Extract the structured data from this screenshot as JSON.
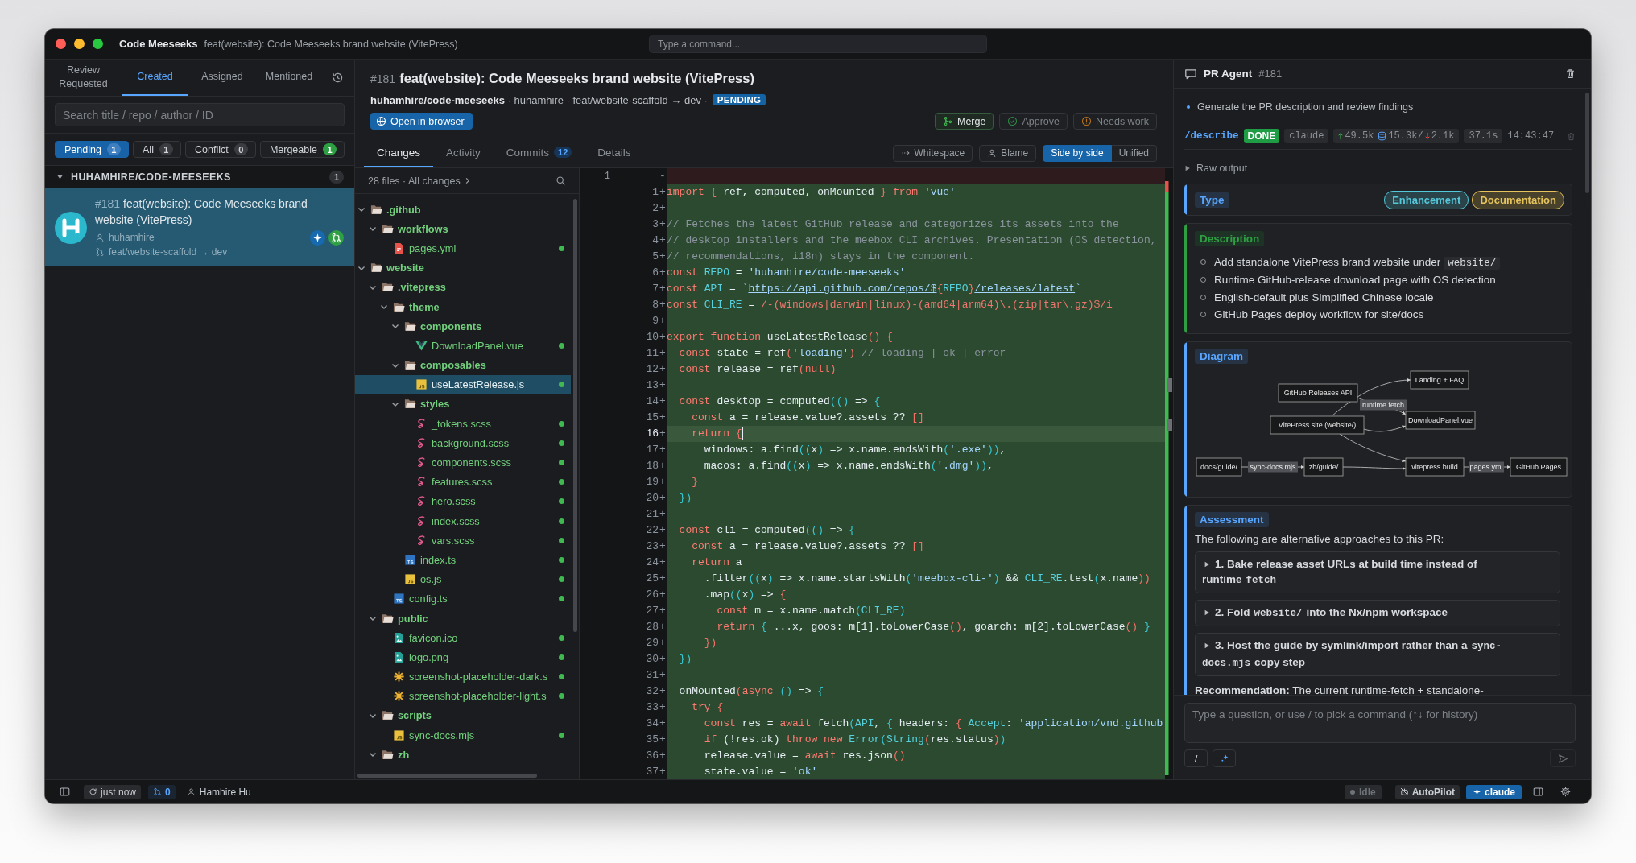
{
  "window": {
    "app_name": "Code Meeseeks",
    "title": "feat(website): Code Meeseeks brand website (VitePress)",
    "command_placeholder": "Type a command..."
  },
  "sidebar": {
    "tabs": [
      {
        "label": "Review Requested",
        "selected": false
      },
      {
        "label": "Created",
        "selected": true
      },
      {
        "label": "Assigned",
        "selected": false
      },
      {
        "label": "Mentioned",
        "selected": false
      }
    ],
    "search_placeholder": "Search title / repo / author / ID",
    "filters": [
      {
        "label": "Pending",
        "count": "1",
        "kind": "default",
        "selected": true
      },
      {
        "label": "All",
        "count": "1",
        "kind": "default",
        "selected": false
      },
      {
        "label": "Conflict",
        "count": "0",
        "kind": "default",
        "selected": false
      },
      {
        "label": "Mergeable",
        "count": "1",
        "kind": "success",
        "selected": false
      }
    ],
    "groups": [
      {
        "name": "HUHAMHIRE/CODE-MEESEEKS",
        "count": "1",
        "expanded": true,
        "items": [
          {
            "number": "#181",
            "title": "feat(website): Code Meeseeks brand website (VitePress)",
            "author": "huhamhire",
            "branch": "feat/website-scaffold → dev",
            "selected": true
          }
        ]
      }
    ]
  },
  "pull_request": {
    "number": "#181",
    "title": "feat(website): Code Meeseeks brand website (VitePress)",
    "meta": "**huhamhire/code-meeseeks** · huhamhire · feat/website-scaffold → dev ·",
    "status": "PENDING",
    "open_button": "Open in browser",
    "actions": [
      {
        "label": "Merge",
        "kind": "merge",
        "disabled": false
      },
      {
        "label": "Approve",
        "kind": "approve",
        "disabled": true
      },
      {
        "label": "Needs work",
        "kind": "needs_work",
        "disabled": true
      }
    ],
    "tabs": [
      {
        "label": "Changes",
        "selected": true
      },
      {
        "label": "Activity",
        "selected": false
      },
      {
        "label": "Commits",
        "count": "12",
        "selected": false
      },
      {
        "label": "Details",
        "selected": false
      }
    ],
    "view_options": [
      {
        "label": "Whitespace",
        "kind": "whitespace"
      },
      {
        "label": "Blame",
        "kind": "blame"
      }
    ],
    "layouts": [
      {
        "label": "Side by side",
        "selected": true
      },
      {
        "label": "Unified",
        "selected": false
      }
    ]
  },
  "file_tree": {
    "summary": "28 files · All changes",
    "items": [
      {
        "kind": "folder",
        "name": ".github",
        "expanded": true,
        "added": false,
        "selected": false,
        "children": [
          {
            "kind": "folder",
            "name": "workflows",
            "expanded": true,
            "added": false,
            "selected": false,
            "children": [
              {
                "kind": "yml",
                "name": "pages.yml",
                "added": true,
                "selected": false
              }
            ]
          }
        ]
      },
      {
        "kind": "folder",
        "name": "website",
        "expanded": true,
        "added": false,
        "selected": false,
        "children": [
          {
            "kind": "folder",
            "name": ".vitepress",
            "expanded": true,
            "added": false,
            "selected": false,
            "children": [
              {
                "kind": "folder",
                "name": "theme",
                "expanded": true,
                "added": false,
                "selected": false,
                "children": [
                  {
                    "kind": "folder",
                    "name": "components",
                    "expanded": true,
                    "added": false,
                    "selected": false,
                    "children": [
                      {
                        "kind": "vue",
                        "name": "DownloadPanel.vue",
                        "added": true,
                        "selected": false
                      }
                    ]
                  },
                  {
                    "kind": "folder",
                    "name": "composables",
                    "expanded": true,
                    "added": false,
                    "selected": false,
                    "children": [
                      {
                        "kind": "js",
                        "name": "useLatestRelease.js",
                        "added": true,
                        "selected": true
                      }
                    ]
                  },
                  {
                    "kind": "folder",
                    "name": "styles",
                    "expanded": true,
                    "added": false,
                    "selected": false,
                    "children": [
                      {
                        "kind": "scss",
                        "name": "_tokens.scss",
                        "added": true,
                        "selected": false
                      },
                      {
                        "kind": "scss",
                        "name": "background.scss",
                        "added": true,
                        "selected": false
                      },
                      {
                        "kind": "scss",
                        "name": "components.scss",
                        "added": true,
                        "selected": false
                      },
                      {
                        "kind": "scss",
                        "name": "features.scss",
                        "added": true,
                        "selected": false
                      },
                      {
                        "kind": "scss",
                        "name": "hero.scss",
                        "added": true,
                        "selected": false
                      },
                      {
                        "kind": "scss",
                        "name": "index.scss",
                        "added": true,
                        "selected": false
                      },
                      {
                        "kind": "scss",
                        "name": "vars.scss",
                        "added": true,
                        "selected": false
                      }
                    ]
                  },
                  {
                    "kind": "ts",
                    "name": "index.ts",
                    "added": true,
                    "selected": false
                  },
                  {
                    "kind": "js",
                    "name": "os.js",
                    "added": true,
                    "selected": false
                  }
                ]
              },
              {
                "kind": "ts",
                "name": "config.ts",
                "added": true,
                "selected": false
              }
            ]
          },
          {
            "kind": "folder",
            "name": "public",
            "expanded": true,
            "added": false,
            "selected": false,
            "children": [
              {
                "kind": "image",
                "name": "favicon.ico",
                "added": true,
                "selected": false
              },
              {
                "kind": "image",
                "name": "logo.png",
                "added": true,
                "selected": false
              },
              {
                "kind": "svg",
                "name": "screenshot-placeholder-dark.s",
                "added": true,
                "selected": false
              },
              {
                "kind": "svg",
                "name": "screenshot-placeholder-light.s",
                "added": true,
                "selected": false
              }
            ]
          },
          {
            "kind": "folder",
            "name": "scripts",
            "expanded": true,
            "added": false,
            "selected": false,
            "children": [
              {
                "kind": "js",
                "name": "sync-docs.mjs",
                "added": true,
                "selected": false
              }
            ]
          },
          {
            "kind": "folder",
            "name": "zh",
            "expanded": true,
            "added": false,
            "selected": false
          }
        ]
      }
    ]
  },
  "diff": {
    "rows": [
      {
        "kind": "removed",
        "number": "1",
        "marker": "-",
        "active": false
      },
      {
        "kind": "added",
        "number": "1",
        "marker": "+",
        "active": false,
        "tokens": [
          {
            "kind": "kw",
            "text": "import "
          },
          {
            "kind": "b1",
            "text": "{"
          },
          {
            "kind": "p",
            "text": " ref, computed, onMounted "
          },
          {
            "kind": "b1",
            "text": "}"
          },
          {
            "kind": "kw",
            "text": " from "
          },
          {
            "kind": "str",
            "text": "'vue'"
          }
        ]
      },
      {
        "kind": "added",
        "number": "2",
        "marker": "+",
        "active": false
      },
      {
        "kind": "added",
        "number": "3",
        "marker": "+",
        "active": false,
        "tokens": [
          {
            "kind": "cm",
            "text": "// Fetches the latest GitHub release and categorizes its assets into the"
          }
        ]
      },
      {
        "kind": "added",
        "number": "4",
        "marker": "+",
        "active": false,
        "tokens": [
          {
            "kind": "cm",
            "text": "// desktop installers and the meebox CLI archives. Presentation (OS detection,"
          }
        ]
      },
      {
        "kind": "added",
        "number": "5",
        "marker": "+",
        "active": false,
        "tokens": [
          {
            "kind": "cm",
            "text": "// recommendations, i18n) stays in the component."
          }
        ]
      },
      {
        "kind": "added",
        "number": "6",
        "marker": "+",
        "active": false,
        "tokens": [
          {
            "kind": "kw",
            "text": "const "
          },
          {
            "kind": "cn",
            "text": "REPO"
          },
          {
            "kind": "p",
            "text": " = "
          },
          {
            "kind": "str",
            "text": "'huhamhire/code-meeseeks'"
          }
        ]
      },
      {
        "kind": "added",
        "number": "7",
        "marker": "+",
        "active": false,
        "tokens": [
          {
            "kind": "kw",
            "text": "const "
          },
          {
            "kind": "cn",
            "text": "API"
          },
          {
            "kind": "p",
            "text": " = "
          },
          {
            "kind": "str",
            "text": "`"
          },
          {
            "kind": "url",
            "text": "https://api.github.com/repos/$"
          },
          {
            "kind": "b1",
            "text": "{"
          },
          {
            "kind": "cn",
            "text": "REPO"
          },
          {
            "kind": "b1",
            "text": "}"
          },
          {
            "kind": "url",
            "text": "/releases/latest"
          },
          {
            "kind": "str",
            "text": "`"
          }
        ]
      },
      {
        "kind": "added",
        "number": "8",
        "marker": "+",
        "active": false,
        "tokens": [
          {
            "kind": "kw",
            "text": "const "
          },
          {
            "kind": "cn",
            "text": "CLI_RE"
          },
          {
            "kind": "p",
            "text": " = "
          },
          {
            "kind": "re",
            "text": "/-(windows|darwin|linux)-(amd64|arm64)\\.(zip|tar\\.gz)$/i"
          }
        ]
      },
      {
        "kind": "added",
        "number": "9",
        "marker": "+",
        "active": false
      },
      {
        "kind": "added",
        "number": "10",
        "marker": "+",
        "active": false,
        "tokens": [
          {
            "kind": "kw",
            "text": "export function "
          },
          {
            "kind": "p",
            "text": "useLatestRelease"
          },
          {
            "kind": "b1",
            "text": "() {"
          }
        ]
      },
      {
        "kind": "added",
        "number": "11",
        "marker": "+",
        "active": false,
        "tokens": [
          {
            "kind": "kw",
            "text": "  const "
          },
          {
            "kind": "p",
            "text": "state = ref"
          },
          {
            "kind": "b1",
            "text": "("
          },
          {
            "kind": "str",
            "text": "'loading'"
          },
          {
            "kind": "b1",
            "text": ")"
          },
          {
            "kind": "cm",
            "text": " // loading | ok | error"
          }
        ]
      },
      {
        "kind": "added",
        "number": "12",
        "marker": "+",
        "active": false,
        "tokens": [
          {
            "kind": "kw",
            "text": "  const "
          },
          {
            "kind": "p",
            "text": "release = ref"
          },
          {
            "kind": "b1",
            "text": "(null)"
          }
        ]
      },
      {
        "kind": "added",
        "number": "13",
        "marker": "+",
        "active": false
      },
      {
        "kind": "added",
        "number": "14",
        "marker": "+",
        "active": false,
        "tokens": [
          {
            "kind": "kw",
            "text": "  const "
          },
          {
            "kind": "p",
            "text": "desktop = computed"
          },
          {
            "kind": "b2",
            "text": "(()"
          },
          {
            "kind": "p",
            "text": " => "
          },
          {
            "kind": "b2",
            "text": "{"
          }
        ]
      },
      {
        "kind": "added",
        "number": "15",
        "marker": "+",
        "active": false,
        "tokens": [
          {
            "kind": "kw",
            "text": "    const "
          },
          {
            "kind": "p",
            "text": "a = release.value?.assets ?? "
          },
          {
            "kind": "b1",
            "text": "[]"
          }
        ]
      },
      {
        "kind": "added",
        "number": "16",
        "marker": "+",
        "active": true,
        "tokens": [
          {
            "kind": "kw",
            "text": "    return "
          },
          {
            "kind": "b1",
            "text": "{"
          }
        ]
      },
      {
        "kind": "added",
        "number": "17",
        "marker": "+",
        "active": false,
        "tokens": [
          {
            "kind": "p",
            "text": "      windows: a.find"
          },
          {
            "kind": "b2",
            "text": "(("
          },
          {
            "kind": "p",
            "text": "x"
          },
          {
            "kind": "b2",
            "text": ")"
          },
          {
            "kind": "p",
            "text": " => x.name.endsWith"
          },
          {
            "kind": "b2",
            "text": "("
          },
          {
            "kind": "str",
            "text": "'.exe'"
          },
          {
            "kind": "b2",
            "text": "))"
          },
          {
            "kind": "p",
            "text": ","
          }
        ]
      },
      {
        "kind": "added",
        "number": "18",
        "marker": "+",
        "active": false,
        "tokens": [
          {
            "kind": "p",
            "text": "      macos: a.find"
          },
          {
            "kind": "b2",
            "text": "(("
          },
          {
            "kind": "p",
            "text": "x"
          },
          {
            "kind": "b2",
            "text": ")"
          },
          {
            "kind": "p",
            "text": " => x.name.endsWith"
          },
          {
            "kind": "b2",
            "text": "("
          },
          {
            "kind": "str",
            "text": "'.dmg'"
          },
          {
            "kind": "b2",
            "text": "))"
          },
          {
            "kind": "p",
            "text": ","
          }
        ]
      },
      {
        "kind": "added",
        "number": "19",
        "marker": "+",
        "active": false,
        "tokens": [
          {
            "kind": "b1",
            "text": "    }"
          }
        ]
      },
      {
        "kind": "added",
        "number": "20",
        "marker": "+",
        "active": false,
        "tokens": [
          {
            "kind": "b2",
            "text": "  })"
          }
        ]
      },
      {
        "kind": "added",
        "number": "21",
        "marker": "+",
        "active": false
      },
      {
        "kind": "added",
        "number": "22",
        "marker": "+",
        "active": false,
        "tokens": [
          {
            "kind": "kw",
            "text": "  const "
          },
          {
            "kind": "p",
            "text": "cli = computed"
          },
          {
            "kind": "b2",
            "text": "(()"
          },
          {
            "kind": "p",
            "text": " => "
          },
          {
            "kind": "b2",
            "text": "{"
          }
        ]
      },
      {
        "kind": "added",
        "number": "23",
        "marker": "+",
        "active": false,
        "tokens": [
          {
            "kind": "kw",
            "text": "    const "
          },
          {
            "kind": "p",
            "text": "a = release.value?.assets ?? "
          },
          {
            "kind": "b1",
            "text": "[]"
          }
        ]
      },
      {
        "kind": "added",
        "number": "24",
        "marker": "+",
        "active": false,
        "tokens": [
          {
            "kind": "kw",
            "text": "    return "
          },
          {
            "kind": "p",
            "text": "a"
          }
        ]
      },
      {
        "kind": "added",
        "number": "25",
        "marker": "+",
        "active": false,
        "tokens": [
          {
            "kind": "p",
            "text": "      .filter"
          },
          {
            "kind": "b2",
            "text": "(("
          },
          {
            "kind": "p",
            "text": "x"
          },
          {
            "kind": "b2",
            "text": ")"
          },
          {
            "kind": "p",
            "text": " => x.name.startsWith"
          },
          {
            "kind": "b2",
            "text": "("
          },
          {
            "kind": "str",
            "text": "'meebox-cli-'"
          },
          {
            "kind": "b2",
            "text": ")"
          },
          {
            "kind": "p",
            "text": " && "
          },
          {
            "kind": "cn",
            "text": "CLI_RE"
          },
          {
            "kind": "p",
            "text": ".test"
          },
          {
            "kind": "b2",
            "text": "("
          },
          {
            "kind": "p",
            "text": "x.name"
          },
          {
            "kind": "b1",
            "text": "))"
          }
        ]
      },
      {
        "kind": "added",
        "number": "26",
        "marker": "+",
        "active": false,
        "tokens": [
          {
            "kind": "p",
            "text": "      .map"
          },
          {
            "kind": "b2",
            "text": "(("
          },
          {
            "kind": "p",
            "text": "x"
          },
          {
            "kind": "b2",
            "text": ")"
          },
          {
            "kind": "p",
            "text": " => "
          },
          {
            "kind": "b1",
            "text": "{"
          }
        ]
      },
      {
        "kind": "added",
        "number": "27",
        "marker": "+",
        "active": false,
        "tokens": [
          {
            "kind": "kw",
            "text": "        const "
          },
          {
            "kind": "p",
            "text": "m = x.name.match"
          },
          {
            "kind": "b2",
            "text": "("
          },
          {
            "kind": "cn",
            "text": "CLI_RE"
          },
          {
            "kind": "b2",
            "text": ")"
          }
        ]
      },
      {
        "kind": "added",
        "number": "28",
        "marker": "+",
        "active": false,
        "tokens": [
          {
            "kind": "kw",
            "text": "        return "
          },
          {
            "kind": "b2",
            "text": "{"
          },
          {
            "kind": "p",
            "text": " ...x, goos: m[1].toLowerCase"
          },
          {
            "kind": "b1",
            "text": "()"
          },
          {
            "kind": "p",
            "text": ", goarch: m[2].toLowerCase"
          },
          {
            "kind": "b1",
            "text": "() "
          },
          {
            "kind": "b2",
            "text": "}"
          }
        ]
      },
      {
        "kind": "added",
        "number": "29",
        "marker": "+",
        "active": false,
        "tokens": [
          {
            "kind": "b1",
            "text": "      })"
          }
        ]
      },
      {
        "kind": "added",
        "number": "30",
        "marker": "+",
        "active": false,
        "tokens": [
          {
            "kind": "b2",
            "text": "  })"
          }
        ]
      },
      {
        "kind": "added",
        "number": "31",
        "marker": "+",
        "active": false
      },
      {
        "kind": "added",
        "number": "32",
        "marker": "+",
        "active": false,
        "tokens": [
          {
            "kind": "p",
            "text": "  onMounted"
          },
          {
            "kind": "b1",
            "text": "("
          },
          {
            "kind": "kw",
            "text": "async "
          },
          {
            "kind": "b2",
            "text": "()"
          },
          {
            "kind": "p",
            "text": " => "
          },
          {
            "kind": "b2",
            "text": "{"
          }
        ]
      },
      {
        "kind": "added",
        "number": "33",
        "marker": "+",
        "active": false,
        "tokens": [
          {
            "kind": "kw",
            "text": "    try "
          },
          {
            "kind": "b1",
            "text": "{"
          }
        ]
      },
      {
        "kind": "added",
        "number": "34",
        "marker": "+",
        "active": false,
        "tokens": [
          {
            "kind": "kw",
            "text": "      const "
          },
          {
            "kind": "p",
            "text": "res = "
          },
          {
            "kind": "kw",
            "text": "await "
          },
          {
            "kind": "p",
            "text": "fetch"
          },
          {
            "kind": "b2",
            "text": "("
          },
          {
            "kind": "cn",
            "text": "API"
          },
          {
            "kind": "p",
            "text": ", "
          },
          {
            "kind": "b2",
            "text": "{"
          },
          {
            "kind": "p",
            "text": " headers: "
          },
          {
            "kind": "b1",
            "text": "{"
          },
          {
            "kind": "cn",
            "text": " Accept"
          },
          {
            "kind": "p",
            "text": ": "
          },
          {
            "kind": "str",
            "text": "'application/vnd.github"
          }
        ]
      },
      {
        "kind": "added",
        "number": "35",
        "marker": "+",
        "active": false,
        "tokens": [
          {
            "kind": "kw",
            "text": "      if "
          },
          {
            "kind": "p",
            "text": "(!res.ok) "
          },
          {
            "kind": "kw",
            "text": "throw new "
          },
          {
            "kind": "cn",
            "text": "Error"
          },
          {
            "kind": "b2",
            "text": "("
          },
          {
            "kind": "cn",
            "text": "String"
          },
          {
            "kind": "b1",
            "text": "("
          },
          {
            "kind": "p",
            "text": "res.status"
          },
          {
            "kind": "b1",
            "text": ")"
          },
          {
            "kind": "b2",
            "text": ")"
          }
        ]
      },
      {
        "kind": "added",
        "number": "36",
        "marker": "+",
        "active": false,
        "tokens": [
          {
            "kind": "p",
            "text": "      release.value = "
          },
          {
            "kind": "kw",
            "text": "await "
          },
          {
            "kind": "p",
            "text": "res.json"
          },
          {
            "kind": "b1",
            "text": "()"
          }
        ]
      },
      {
        "kind": "added",
        "number": "37",
        "marker": "+",
        "active": false,
        "tokens": [
          {
            "kind": "p",
            "text": "      state.value = "
          },
          {
            "kind": "str",
            "text": "'ok'"
          }
        ]
      }
    ]
  },
  "agent": {
    "title": "PR Agent",
    "number": "#181",
    "task": "Generate the PR description and review findings",
    "run": {
      "command": "/describe",
      "status": "DONE",
      "model": "claude",
      "tokens_in": "49.5k",
      "tokens_cached": "15.3k/",
      "tokens_out": "2.1k",
      "duration": "37.1s",
      "time": "14:43:47"
    },
    "raw_output": {
      "label": "Raw output",
      "expanded": false
    },
    "sections": [
      {
        "kind": "tags",
        "title": "Type",
        "color": "#58a6ff",
        "tags": [
          {
            "label": "Enhancement",
            "color": "#56c8dc"
          },
          {
            "label": "Documentation",
            "color": "#e6c35c"
          }
        ]
      },
      {
        "kind": "bullets",
        "title": "Description",
        "color": "#2ea043",
        "items": [
          {
            "parts": [
              {
                "kind": "text",
                "text": "Add standalone VitePress brand website under"
              },
              {
                "kind": "code",
                "text": "website/"
              }
            ]
          },
          {
            "parts": [
              {
                "kind": "text",
                "text": "Runtime GitHub-release download page with OS detection"
              }
            ]
          },
          {
            "parts": [
              {
                "kind": "text",
                "text": "English-default plus Simplified Chinese locale"
              }
            ]
          },
          {
            "parts": [
              {
                "kind": "text",
                "text": "GitHub Pages deploy workflow for site/docs"
              }
            ]
          }
        ]
      },
      {
        "kind": "diagram",
        "title": "Diagram",
        "color": "#58a6ff",
        "nodes": [
          "GitHub Releases API",
          "Landing + FAQ",
          "DownloadPanel.vue",
          "VitePress site (website/)",
          "docs/guide/",
          "zh/guide/",
          "vitepress build",
          "GitHub Pages"
        ],
        "edge_labels": [
          "runtime fetch",
          "sync-docs.mjs",
          "pages.yml"
        ]
      },
      {
        "kind": "assessment",
        "title": "Assessment",
        "color": "#58a6ff",
        "intro": "The following are alternative approaches to this PR:",
        "alternatives": [
          {
            "expanded": false,
            "parts": [
              {
                "kind": "text",
                "text": "1. Bake release asset URLs at build time instead of runtime"
              },
              {
                "kind": "code",
                "text": "fetch"
              }
            ]
          },
          {
            "expanded": false,
            "parts": [
              {
                "kind": "text",
                "text": "2. Fold"
              },
              {
                "kind": "code",
                "text": "website/"
              },
              {
                "kind": "text",
                "text": "into the Nx/npm workspace"
              }
            ]
          },
          {
            "expanded": false,
            "parts": [
              {
                "kind": "text",
                "text": "3. Host the guide by symlink/import rather than a"
              },
              {
                "kind": "code",
                "text": "sync-docs.mjs"
              },
              {
                "kind": "text",
                "text": "copy step"
              }
            ]
          }
        ],
        "recommendation": "**Recommendation:** The current runtime-fetch + standalone-"
      }
    ],
    "input_placeholder": "Type a question, or use / to pick a command (↑↓ for history)",
    "slash_button": "/"
  },
  "status_bar": {
    "sync": "just now",
    "open_prs": "0",
    "user": "Hamhire Hu",
    "agent_state": "Idle",
    "autopilot": {
      "label": "AutoPilot",
      "on": false
    },
    "model": "claude"
  }
}
